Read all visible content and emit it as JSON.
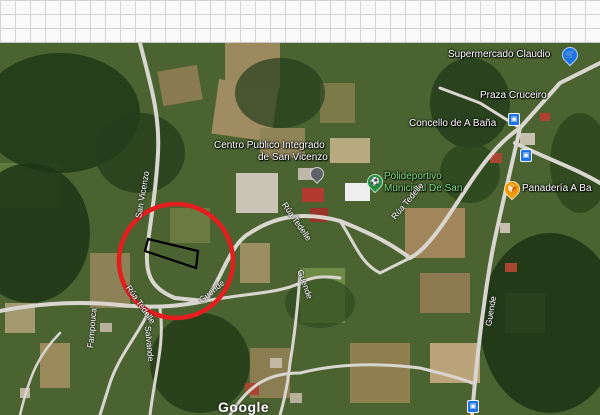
{
  "map": {
    "labels": {
      "supermarket": "Supermercado Claudio",
      "square": "Praza Cruceiro",
      "council": "Concello de A Baña",
      "school": "Centro Público Integrado de San Vicenzo",
      "school_line1": "Centro Publico Integrado",
      "school_line2": "de San Vicenzo",
      "sports_line1": "Polideportivo",
      "sports_line2": "Municipal De San",
      "bakery": "Panadería A Ba"
    },
    "streets": {
      "san_vicenzo": "San Vicenzo",
      "rua_tedelle_1": "Rúa Tedelle",
      "rua_tedelle_2": "Rúa Tedelle",
      "rua_tedelle_3": "Rúa Tedelle",
      "guende_1": "Guende",
      "guende_2": "Guende",
      "guende_3": "Guende",
      "salvande": "Salvande",
      "fampouca": "Fampouca"
    },
    "attribution": "Google",
    "icons": [
      "shopping-cart-icon",
      "bus-stop-icon",
      "sports-icon",
      "bakery-icon"
    ],
    "colors": {
      "highlight_circle": "#e41e1e",
      "parcel_outline": "#000000",
      "bakery_pin": "#f29900",
      "sports_pin": "#1e8e3e",
      "shop_pin": "#1a73e8"
    }
  }
}
